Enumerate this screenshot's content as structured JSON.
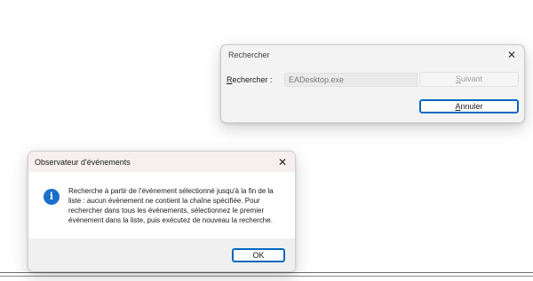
{
  "find_dialog": {
    "title": "Rechercher",
    "label": "Rechercher :",
    "input_value": "EADesktop.exe",
    "next_button": "Suivant",
    "cancel_button": "Annuler",
    "close_icon": "close-icon"
  },
  "message_box": {
    "title": "Observateur d'événements",
    "icon": "info-icon",
    "message": "Recherche à partir de l'événement sélectionné jusqu'à la fin de la liste : aucun événement ne contient la chaîne spécifiée. Pour rechercher dans tous les événements, sélectionnez le premier événement dans la liste, puis exécutez de nouveau la recherche.",
    "ok_button": "OK",
    "close_icon": "close-icon"
  },
  "colors": {
    "accent": "#0067c0",
    "info_icon": "#1a6fc9",
    "message_titlebar": "#f7efef",
    "footer": "#f0f0f0"
  }
}
